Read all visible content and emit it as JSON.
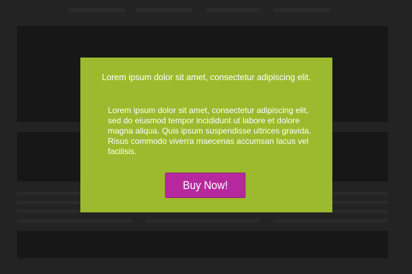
{
  "modal": {
    "headline": "Lorem ipsum dolor sit amet, consectetur adipiscing elit.",
    "body": "Lorem ipsum dolor sit amet, consectetur adipiscing elit, sed do eiusmod tempor incididunt ut labore et dolore magna aliqua. Quis ipsum suspendisse ultrices gravida. Risus commodo viverra maecenas accumsan lacus vel facilisis.",
    "cta_label": "Buy Now!"
  },
  "colors": {
    "modal_background": "#9cba2d",
    "cta_background": "#b6299e",
    "page_background": "#2b2b2b",
    "text": "#ffffff"
  }
}
